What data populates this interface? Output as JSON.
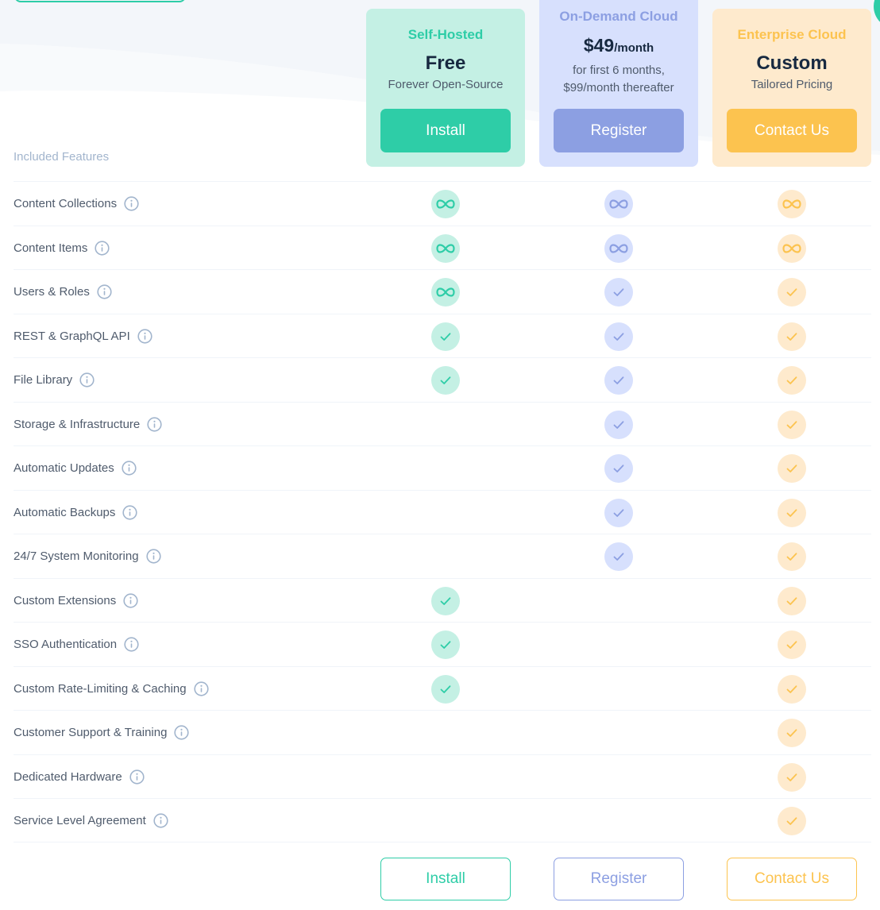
{
  "colors": {
    "selfhosted_accent": "#2ecda7",
    "selfhosted_bg": "#c4f0e4",
    "ondemand_accent": "#8c9fe2",
    "ondemand_bg": "#d7e0fd",
    "enterprise_accent": "#fcc34f",
    "enterprise_bg": "#feeacd",
    "text_dark": "#172940",
    "text_muted": "#4f5b6c",
    "heading_muted": "#a2b5cd"
  },
  "plans": [
    {
      "name": "Self-Hosted",
      "price": "Free",
      "price_suffix": "",
      "description_line1": "Forever Open-Source",
      "description_line2": "",
      "button_label": "Install"
    },
    {
      "name": "On-Demand Cloud",
      "price": "$49",
      "price_suffix": "/month",
      "description_line1": "for first 6 months,",
      "description_line2": "$99/month thereafter",
      "button_label": "Register"
    },
    {
      "name": "Enterprise Cloud",
      "price": "Custom",
      "price_suffix": "",
      "description_line1": "Tailored Pricing",
      "description_line2": "",
      "button_label": "Contact Us"
    }
  ],
  "features_heading": "Included Features",
  "features": [
    {
      "label": "Content Collections",
      "values": [
        "infinity",
        "infinity",
        "infinity"
      ]
    },
    {
      "label": "Content Items",
      "values": [
        "infinity",
        "infinity",
        "infinity"
      ]
    },
    {
      "label": "Users & Roles",
      "values": [
        "infinity",
        "check",
        "check"
      ]
    },
    {
      "label": "REST & GraphQL API",
      "values": [
        "check",
        "check",
        "check"
      ]
    },
    {
      "label": "File Library",
      "values": [
        "check",
        "check",
        "check"
      ]
    },
    {
      "label": "Storage & Infrastructure",
      "values": [
        "none",
        "check",
        "check"
      ]
    },
    {
      "label": "Automatic Updates",
      "values": [
        "none",
        "check",
        "check"
      ]
    },
    {
      "label": "Automatic Backups",
      "values": [
        "none",
        "check",
        "check"
      ]
    },
    {
      "label": "24/7 System Monitoring",
      "values": [
        "none",
        "check",
        "check"
      ]
    },
    {
      "label": "Custom Extensions",
      "values": [
        "check",
        "none",
        "check"
      ]
    },
    {
      "label": "SSO Authentication",
      "values": [
        "check",
        "none",
        "check"
      ]
    },
    {
      "label": "Custom Rate-Limiting & Caching",
      "values": [
        "check",
        "none",
        "check"
      ]
    },
    {
      "label": "Customer Support & Training",
      "values": [
        "none",
        "none",
        "check"
      ]
    },
    {
      "label": "Dedicated Hardware",
      "values": [
        "none",
        "none",
        "check"
      ]
    },
    {
      "label": "Service Level Agreement",
      "values": [
        "none",
        "none",
        "check"
      ]
    }
  ],
  "bottom_buttons": [
    "Install",
    "Register",
    "Contact Us"
  ]
}
